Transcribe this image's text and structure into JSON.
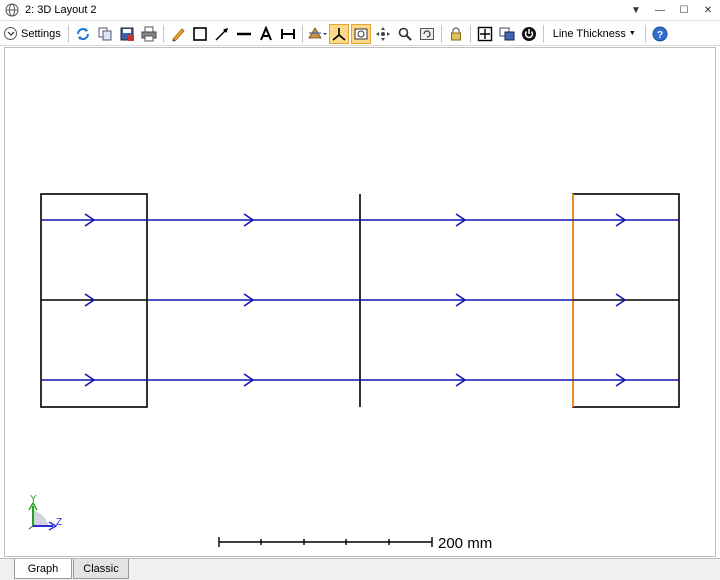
{
  "window": {
    "title": "2: 3D Layout 2"
  },
  "toolbar": {
    "settings_label": "Settings",
    "line_thickness_label": "Line Thickness",
    "icons": [
      "refresh-icon",
      "copy-icon",
      "save-icon",
      "print-icon",
      "pencil-icon",
      "rectangle-icon",
      "arrow-icon",
      "line-icon",
      "text-icon",
      "dimension-icon",
      "rotate-view-icon",
      "axis-icon",
      "camera-icon",
      "pan-icon",
      "zoom-icon",
      "reset-view-icon",
      "lock-icon",
      "fit-icon",
      "window-icon",
      "power-icon",
      "help-icon"
    ]
  },
  "canvas": {
    "scale_label": "200 mm",
    "axis_y_label": "Y",
    "axis_z_label": "Z",
    "colors": {
      "ray": "#1414b4",
      "surface": "#000000",
      "detector": "#f08c28",
      "axis_y": "#1fa61f",
      "axis_z": "#2a2ad6"
    }
  },
  "tabs": [
    {
      "label": "Graph",
      "active": true
    },
    {
      "label": "Classic",
      "active": false
    }
  ]
}
